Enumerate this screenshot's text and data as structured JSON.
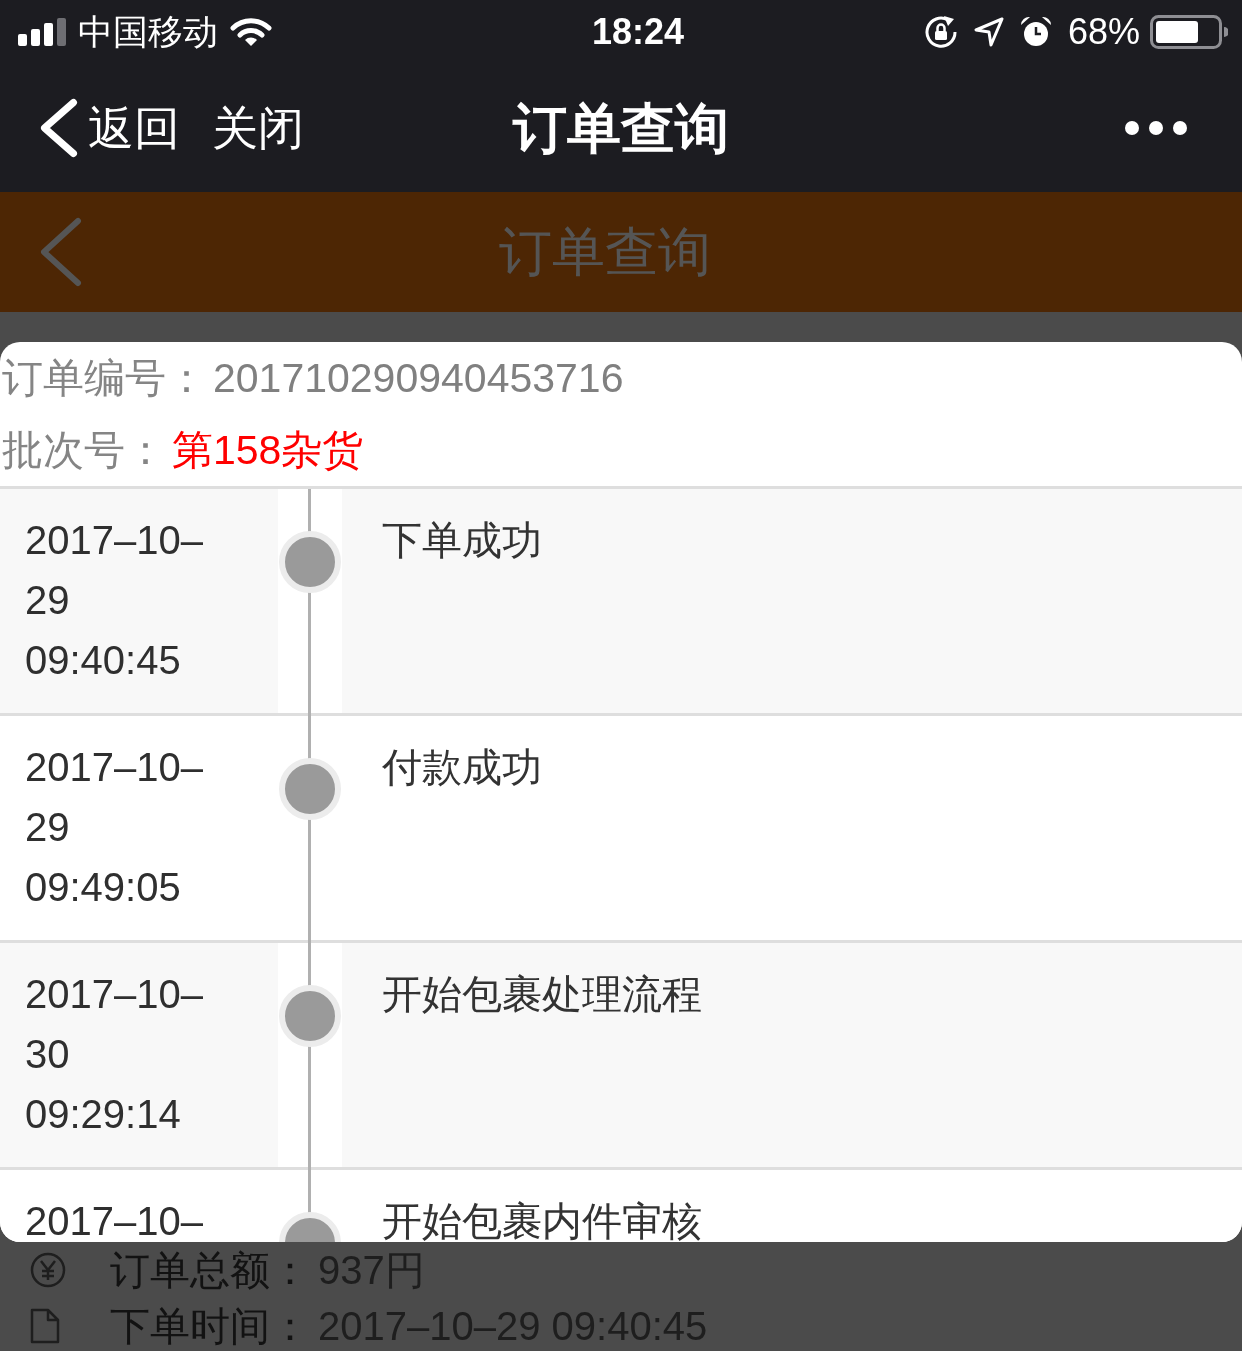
{
  "status_bar": {
    "carrier": "中国移动",
    "time": "18:24",
    "battery": "68%"
  },
  "nav_bar": {
    "back": "返回",
    "close": "关闭",
    "title": "订单查询"
  },
  "page_header": {
    "title": "订单查询"
  },
  "order_card": {
    "order_number": {
      "label": "订单编号：",
      "value": "201710290940453716"
    },
    "batch": {
      "label": "批次号：",
      "value": "第158杂货"
    },
    "events": [
      {
        "time": "2017–10–29 09:40:45",
        "status": "下单成功"
      },
      {
        "time": "2017–10–29 09:49:05",
        "status": "付款成功"
      },
      {
        "time": "2017–10–30 09:29:14",
        "status": "开始包裹处理流程"
      },
      {
        "time": "2017–10–",
        "status": "开始包裹内件审核"
      }
    ]
  },
  "order_summary": [
    {
      "kind": "amount",
      "label": "订单总额：",
      "value": "937円"
    },
    {
      "kind": "time",
      "label": "下单时间：",
      "value": "2017–10–29 09:40:45"
    }
  ]
}
